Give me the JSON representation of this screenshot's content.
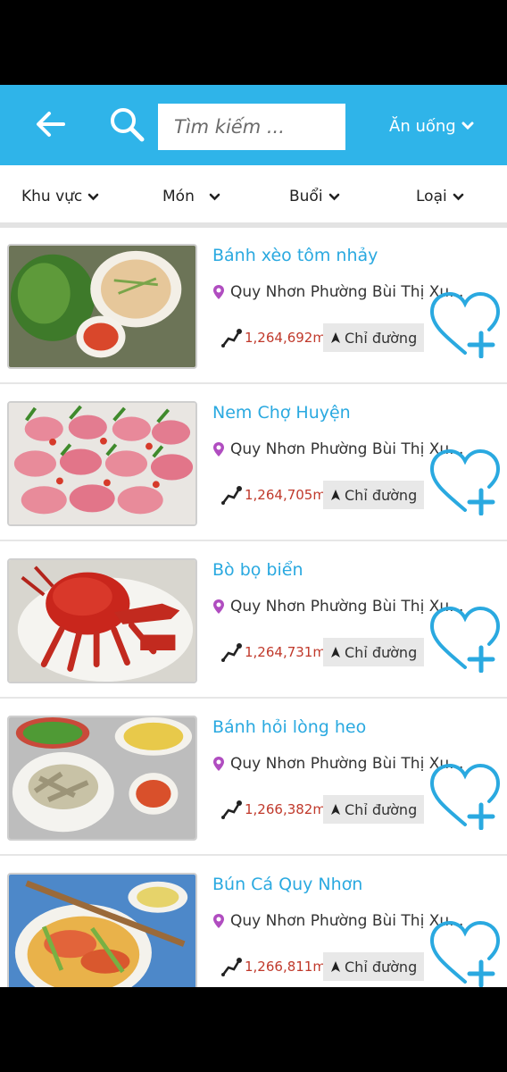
{
  "header": {
    "back_icon": "arrow-left-icon",
    "search_icon": "search-icon",
    "search_placeholder": "Tìm kiếm ...",
    "category_label": "Ăn uống",
    "bg_color": "#2fb4e9"
  },
  "filters": [
    {
      "label": "Khu vực"
    },
    {
      "label": "Món"
    },
    {
      "label": "Buổi"
    },
    {
      "label": "Loại"
    }
  ],
  "items": [
    {
      "title": "Bánh xèo tôm nhảy",
      "address": "Quy Nhơn Phường Bùi Thị Xu...",
      "distance": "1,264,692m",
      "directions_label": "Chỉ đường"
    },
    {
      "title": "Nem Chợ Huyện",
      "address": "Quy Nhơn Phường Bùi Thị Xu...",
      "distance": "1,264,705m",
      "directions_label": "Chỉ đường"
    },
    {
      "title": "Bò bọ biển",
      "address": "Quy Nhơn Phường Bùi Thị Xu...",
      "distance": "1,264,731m",
      "directions_label": "Chỉ đường"
    },
    {
      "title": "Bánh hỏi lòng heo",
      "address": "Quy Nhơn Phường Bùi Thị Xu...",
      "distance": "1,266,382m",
      "directions_label": "Chỉ đường"
    },
    {
      "title": "Bún Cá Quy Nhơn",
      "address": "Quy Nhơn Phường Bùi Thị Xu...",
      "distance": "1,266,811m",
      "directions_label": "Chỉ đường"
    }
  ],
  "colors": {
    "accent": "#2aa9e0",
    "distance": "#c0392b",
    "pin": "#b04dc0"
  }
}
